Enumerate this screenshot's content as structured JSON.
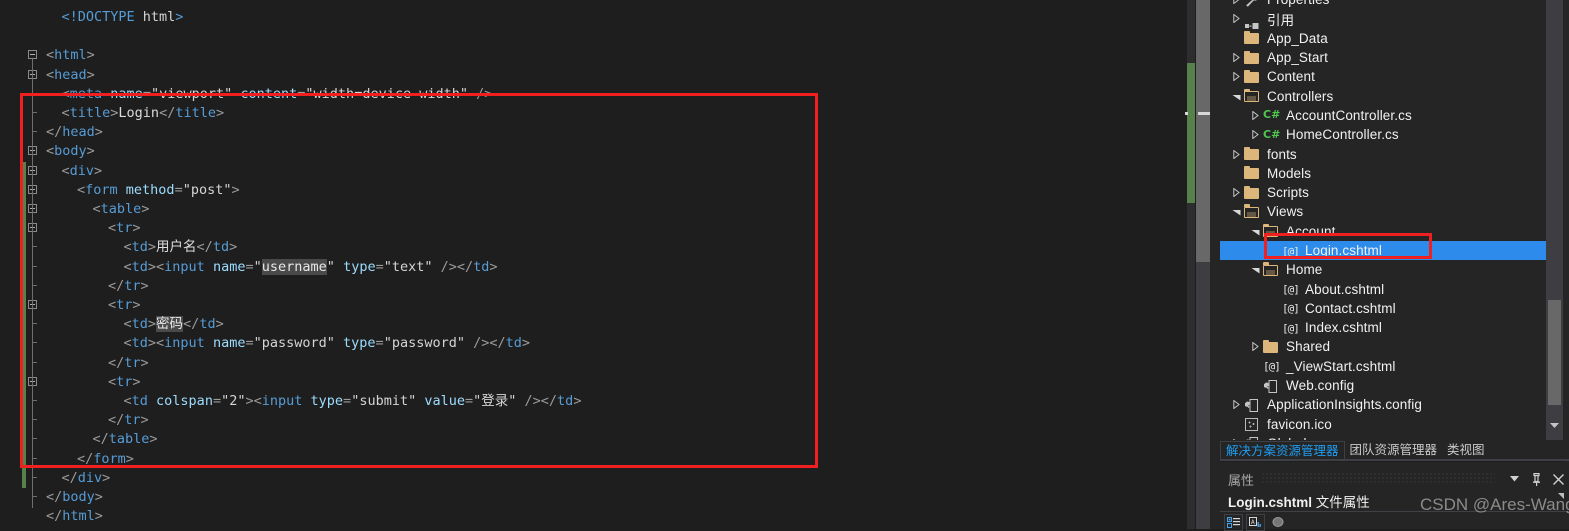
{
  "editor": {
    "lines": [
      {
        "indent": 2,
        "tokens": [
          {
            "c": "t-doct",
            "t": "<!DOCTYPE "
          },
          {
            "c": "t-doctw",
            "t": "html"
          },
          {
            "c": "t-doct",
            "t": ">"
          }
        ]
      },
      {
        "indent": 0,
        "tokens": []
      },
      {
        "indent": 0,
        "tokens": [
          {
            "c": "t-punc",
            "t": "<"
          },
          {
            "c": "t-tag",
            "t": "html"
          },
          {
            "c": "t-punc",
            "t": ">"
          }
        ]
      },
      {
        "indent": 0,
        "tokens": [
          {
            "c": "t-punc",
            "t": "<"
          },
          {
            "c": "t-tag",
            "t": "head"
          },
          {
            "c": "t-punc",
            "t": ">"
          }
        ]
      },
      {
        "indent": 2,
        "tokens": [
          {
            "c": "t-punc",
            "t": "<"
          },
          {
            "c": "t-tag",
            "t": "meta"
          },
          {
            "c": "t-val",
            "t": " "
          },
          {
            "c": "t-attr",
            "t": "name"
          },
          {
            "c": "t-punc",
            "t": "="
          },
          {
            "c": "t-val",
            "t": "\"viewport\""
          },
          {
            "c": "t-val",
            "t": " "
          },
          {
            "c": "t-attr",
            "t": "content"
          },
          {
            "c": "t-punc",
            "t": "="
          },
          {
            "c": "t-val",
            "t": "\"width=device-width\""
          },
          {
            "c": "t-punc",
            "t": " />"
          }
        ]
      },
      {
        "indent": 2,
        "tokens": [
          {
            "c": "t-punc",
            "t": "<"
          },
          {
            "c": "t-tag",
            "t": "title"
          },
          {
            "c": "t-punc",
            "t": ">"
          },
          {
            "c": "t-text",
            "t": "Login"
          },
          {
            "c": "t-punc",
            "t": "</"
          },
          {
            "c": "t-tag",
            "t": "title"
          },
          {
            "c": "t-punc",
            "t": ">"
          }
        ]
      },
      {
        "indent": 0,
        "tokens": [
          {
            "c": "t-punc",
            "t": "</"
          },
          {
            "c": "t-tag",
            "t": "head"
          },
          {
            "c": "t-punc",
            "t": ">"
          }
        ]
      },
      {
        "indent": 0,
        "tokens": [
          {
            "c": "t-punc",
            "t": "<"
          },
          {
            "c": "t-tag",
            "t": "body"
          },
          {
            "c": "t-punc",
            "t": ">"
          }
        ]
      },
      {
        "indent": 2,
        "tokens": [
          {
            "c": "t-punc",
            "t": "<"
          },
          {
            "c": "t-tag",
            "t": "div"
          },
          {
            "c": "t-punc",
            "t": ">"
          }
        ]
      },
      {
        "indent": 4,
        "tokens": [
          {
            "c": "t-punc",
            "t": "<"
          },
          {
            "c": "t-tag",
            "t": "form"
          },
          {
            "c": "t-val",
            "t": " "
          },
          {
            "c": "t-attr",
            "t": "method"
          },
          {
            "c": "t-punc",
            "t": "="
          },
          {
            "c": "t-val",
            "t": "\"post\""
          },
          {
            "c": "t-punc",
            "t": ">"
          }
        ]
      },
      {
        "indent": 6,
        "tokens": [
          {
            "c": "t-punc",
            "t": "<"
          },
          {
            "c": "t-tag",
            "t": "table"
          },
          {
            "c": "t-punc",
            "t": ">"
          }
        ]
      },
      {
        "indent": 8,
        "tokens": [
          {
            "c": "t-punc",
            "t": "<"
          },
          {
            "c": "t-tag",
            "t": "tr"
          },
          {
            "c": "t-punc",
            "t": ">"
          }
        ]
      },
      {
        "indent": 10,
        "tokens": [
          {
            "c": "t-punc",
            "t": "<"
          },
          {
            "c": "t-tag",
            "t": "td"
          },
          {
            "c": "t-punc",
            "t": ">"
          },
          {
            "c": "t-text",
            "t": "用户名"
          },
          {
            "c": "t-punc",
            "t": "</"
          },
          {
            "c": "t-tag",
            "t": "td"
          },
          {
            "c": "t-punc",
            "t": ">"
          }
        ]
      },
      {
        "indent": 10,
        "tokens": [
          {
            "c": "t-punc",
            "t": "<"
          },
          {
            "c": "t-tag",
            "t": "td"
          },
          {
            "c": "t-punc",
            "t": "><"
          },
          {
            "c": "t-tag",
            "t": "input"
          },
          {
            "c": "t-val",
            "t": " "
          },
          {
            "c": "t-attr",
            "t": "name"
          },
          {
            "c": "t-punc",
            "t": "="
          },
          {
            "c": "t-val",
            "t": "\""
          },
          {
            "c": "sel",
            "t": "username"
          },
          {
            "c": "t-val",
            "t": "\""
          },
          {
            "c": "t-val",
            "t": " "
          },
          {
            "c": "t-attr",
            "t": "type"
          },
          {
            "c": "t-punc",
            "t": "="
          },
          {
            "c": "t-val",
            "t": "\"text\""
          },
          {
            "c": "t-punc",
            "t": " /></"
          },
          {
            "c": "t-tag",
            "t": "td"
          },
          {
            "c": "t-punc",
            "t": ">"
          }
        ]
      },
      {
        "indent": 8,
        "tokens": [
          {
            "c": "t-punc",
            "t": "</"
          },
          {
            "c": "t-tag",
            "t": "tr"
          },
          {
            "c": "t-punc",
            "t": ">"
          }
        ]
      },
      {
        "indent": 8,
        "tokens": [
          {
            "c": "t-punc",
            "t": "<"
          },
          {
            "c": "t-tag",
            "t": "tr"
          },
          {
            "c": "t-punc",
            "t": ">"
          }
        ]
      },
      {
        "indent": 10,
        "tokens": [
          {
            "c": "t-punc",
            "t": "<"
          },
          {
            "c": "t-tag",
            "t": "td"
          },
          {
            "c": "t-punc",
            "t": ">"
          },
          {
            "c": "sel",
            "t": "密码"
          },
          {
            "c": "t-punc",
            "t": "</"
          },
          {
            "c": "t-tag",
            "t": "td"
          },
          {
            "c": "t-punc",
            "t": ">"
          }
        ]
      },
      {
        "indent": 10,
        "tokens": [
          {
            "c": "t-punc",
            "t": "<"
          },
          {
            "c": "t-tag",
            "t": "td"
          },
          {
            "c": "t-punc",
            "t": "><"
          },
          {
            "c": "t-tag",
            "t": "input"
          },
          {
            "c": "t-val",
            "t": " "
          },
          {
            "c": "t-attr",
            "t": "name"
          },
          {
            "c": "t-punc",
            "t": "="
          },
          {
            "c": "t-val",
            "t": "\"password\""
          },
          {
            "c": "t-val",
            "t": " "
          },
          {
            "c": "t-attr",
            "t": "type"
          },
          {
            "c": "t-punc",
            "t": "="
          },
          {
            "c": "t-val",
            "t": "\"password\""
          },
          {
            "c": "t-punc",
            "t": " /></"
          },
          {
            "c": "t-tag",
            "t": "td"
          },
          {
            "c": "t-punc",
            "t": ">"
          }
        ]
      },
      {
        "indent": 8,
        "tokens": [
          {
            "c": "t-punc",
            "t": "</"
          },
          {
            "c": "t-tag",
            "t": "tr"
          },
          {
            "c": "t-punc",
            "t": ">"
          }
        ]
      },
      {
        "indent": 8,
        "tokens": [
          {
            "c": "t-punc",
            "t": "<"
          },
          {
            "c": "t-tag",
            "t": "tr"
          },
          {
            "c": "t-punc",
            "t": ">"
          }
        ]
      },
      {
        "indent": 10,
        "tokens": [
          {
            "c": "t-punc",
            "t": "<"
          },
          {
            "c": "t-tag",
            "t": "td"
          },
          {
            "c": "t-val",
            "t": " "
          },
          {
            "c": "t-attr",
            "t": "colspan"
          },
          {
            "c": "t-punc",
            "t": "="
          },
          {
            "c": "t-val",
            "t": "\"2\""
          },
          {
            "c": "t-punc",
            "t": "><"
          },
          {
            "c": "t-tag",
            "t": "input"
          },
          {
            "c": "t-val",
            "t": " "
          },
          {
            "c": "t-attr",
            "t": "type"
          },
          {
            "c": "t-punc",
            "t": "="
          },
          {
            "c": "t-val",
            "t": "\"submit\""
          },
          {
            "c": "t-val",
            "t": " "
          },
          {
            "c": "t-attr",
            "t": "value"
          },
          {
            "c": "t-punc",
            "t": "="
          },
          {
            "c": "t-val",
            "t": "\"登录\""
          },
          {
            "c": "t-punc",
            "t": " /></"
          },
          {
            "c": "t-tag",
            "t": "td"
          },
          {
            "c": "t-punc",
            "t": ">"
          }
        ]
      },
      {
        "indent": 8,
        "tokens": [
          {
            "c": "t-punc",
            "t": "</"
          },
          {
            "c": "t-tag",
            "t": "tr"
          },
          {
            "c": "t-punc",
            "t": ">"
          }
        ]
      },
      {
        "indent": 6,
        "tokens": [
          {
            "c": "t-punc",
            "t": "</"
          },
          {
            "c": "t-tag",
            "t": "table"
          },
          {
            "c": "t-punc",
            "t": ">"
          }
        ]
      },
      {
        "indent": 4,
        "tokens": [
          {
            "c": "t-punc",
            "t": "</"
          },
          {
            "c": "t-tag",
            "t": "form"
          },
          {
            "c": "t-punc",
            "t": ">"
          }
        ]
      },
      {
        "indent": 2,
        "tokens": [
          {
            "c": "t-punc",
            "t": "</"
          },
          {
            "c": "t-tag",
            "t": "div"
          },
          {
            "c": "t-punc",
            "t": ">"
          }
        ]
      },
      {
        "indent": 0,
        "tokens": [
          {
            "c": "t-punc",
            "t": "</"
          },
          {
            "c": "t-tag",
            "t": "body"
          },
          {
            "c": "t-punc",
            "t": ">"
          }
        ]
      },
      {
        "indent": 0,
        "tokens": [
          {
            "c": "t-punc",
            "t": "</"
          },
          {
            "c": "t-tag",
            "t": "html"
          },
          {
            "c": "t-punc",
            "t": ">"
          }
        ]
      }
    ]
  },
  "solution_explorer": {
    "items": [
      {
        "depth": 1,
        "label": "Properties",
        "icon": "wrench-icon",
        "expander": "closed",
        "selected": false
      },
      {
        "depth": 1,
        "label": "引用",
        "icon": "references-icon",
        "expander": "closed",
        "selected": false
      },
      {
        "depth": 1,
        "label": "App_Data",
        "icon": "folder-icon",
        "expander": "none",
        "selected": false
      },
      {
        "depth": 1,
        "label": "App_Start",
        "icon": "folder-icon",
        "expander": "closed",
        "selected": false
      },
      {
        "depth": 1,
        "label": "Content",
        "icon": "folder-icon",
        "expander": "closed",
        "selected": false
      },
      {
        "depth": 1,
        "label": "Controllers",
        "icon": "folder-open-icon",
        "expander": "open",
        "selected": false
      },
      {
        "depth": 2,
        "label": "AccountController.cs",
        "icon": "csharp-icon",
        "expander": "closed",
        "selected": false
      },
      {
        "depth": 2,
        "label": "HomeController.cs",
        "icon": "csharp-icon",
        "expander": "closed",
        "selected": false
      },
      {
        "depth": 1,
        "label": "fonts",
        "icon": "folder-icon",
        "expander": "closed",
        "selected": false
      },
      {
        "depth": 1,
        "label": "Models",
        "icon": "folder-icon",
        "expander": "none",
        "selected": false
      },
      {
        "depth": 1,
        "label": "Scripts",
        "icon": "folder-icon",
        "expander": "closed",
        "selected": false
      },
      {
        "depth": 1,
        "label": "Views",
        "icon": "folder-open-icon",
        "expander": "open",
        "selected": false
      },
      {
        "depth": 2,
        "label": "Account",
        "icon": "folder-open-icon",
        "expander": "open",
        "selected": false
      },
      {
        "depth": 3,
        "label": "Login.cshtml",
        "icon": "cshtml-icon",
        "expander": "none",
        "selected": true
      },
      {
        "depth": 2,
        "label": "Home",
        "icon": "folder-open-icon",
        "expander": "open",
        "selected": false
      },
      {
        "depth": 3,
        "label": "About.cshtml",
        "icon": "cshtml-icon",
        "expander": "none",
        "selected": false
      },
      {
        "depth": 3,
        "label": "Contact.cshtml",
        "icon": "cshtml-icon",
        "expander": "none",
        "selected": false
      },
      {
        "depth": 3,
        "label": "Index.cshtml",
        "icon": "cshtml-icon",
        "expander": "none",
        "selected": false
      },
      {
        "depth": 2,
        "label": "Shared",
        "icon": "folder-icon",
        "expander": "closed",
        "selected": false
      },
      {
        "depth": 2,
        "label": "_ViewStart.cshtml",
        "icon": "cshtml-icon",
        "expander": "none",
        "selected": false
      },
      {
        "depth": 2,
        "label": "Web.config",
        "icon": "config-icon",
        "expander": "none",
        "selected": false
      },
      {
        "depth": 1,
        "label": "ApplicationInsights.config",
        "icon": "config-icon",
        "expander": "closed",
        "selected": false
      },
      {
        "depth": 1,
        "label": "favicon.ico",
        "icon": "ico-icon",
        "expander": "none",
        "selected": false
      },
      {
        "depth": 1,
        "label": "Global.asax",
        "icon": "config-icon",
        "expander": "closed",
        "selected": false
      }
    ]
  },
  "panel_tabs": [
    {
      "label": "解决方案资源管理器",
      "active": true
    },
    {
      "label": "团队资源管理器",
      "active": false
    },
    {
      "label": "类视图",
      "active": false
    }
  ],
  "properties_panel": {
    "title": "属性",
    "file_name": "Login.cshtml",
    "file_suffix": " 文件属性",
    "dropdown_icon": "chevron-down-icon",
    "pin_icon": "pin-icon",
    "close_icon": "close-icon",
    "toolbar": [
      {
        "icon": "categorized-view-icon"
      },
      {
        "icon": "alphabetical-view-icon"
      },
      {
        "icon": "properties-page-icon"
      }
    ]
  },
  "watermark": {
    "text": "CSDN @Ares-Wang"
  },
  "colors": {
    "editor_bg": "#1e1e1e",
    "panel_bg": "#252526",
    "selection_blue": "#2d8ceb",
    "annotation_red": "#f02020",
    "change_bar_green": "#57814a",
    "tag_blue": "#569cd6",
    "attr_blue": "#9cdcfe",
    "folder_gold": "#dcb67a",
    "active_tab_blue": "#1e9cf0"
  }
}
